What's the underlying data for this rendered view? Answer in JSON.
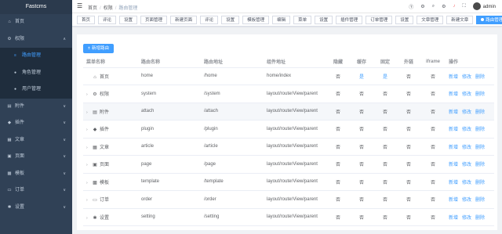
{
  "brand": "Fastcms",
  "sidebar": {
    "items": [
      {
        "label": "首页",
        "icon": "home-icon",
        "glyph": "⌂",
        "arrow": ""
      },
      {
        "label": "权限",
        "icon": "gear-icon",
        "glyph": "⚙",
        "arrow": "∧"
      },
      {
        "label": "附件",
        "icon": "folder-icon",
        "glyph": "▤",
        "arrow": "∨"
      },
      {
        "label": "插件",
        "icon": "plugin-icon",
        "glyph": "◆",
        "arrow": "∨"
      },
      {
        "label": "文章",
        "icon": "document-icon",
        "glyph": "▦",
        "arrow": "∨"
      },
      {
        "label": "页面",
        "icon": "page-icon",
        "glyph": "▣",
        "arrow": "∨"
      },
      {
        "label": "模板",
        "icon": "template-icon",
        "glyph": "▩",
        "arrow": "∨"
      },
      {
        "label": "订单",
        "icon": "cart-icon",
        "glyph": "▭",
        "arrow": "∨"
      },
      {
        "label": "设置",
        "icon": "settings-icon",
        "glyph": "✱",
        "arrow": "∨"
      }
    ],
    "sub_items": [
      {
        "label": "路由管理",
        "icon": "menu-icon",
        "glyph": "≡",
        "active": true
      },
      {
        "label": "角色管理",
        "icon": "user-icon",
        "glyph": "●",
        "active": false
      },
      {
        "label": "用户管理",
        "icon": "user-icon",
        "glyph": "●",
        "active": false
      }
    ]
  },
  "breadcrumb": [
    "首页",
    "权限",
    "路由管理"
  ],
  "header": {
    "user": "admin"
  },
  "tags": [
    {
      "label": "首页",
      "active": false
    },
    {
      "label": "评论",
      "active": false
    },
    {
      "label": "设置",
      "active": false
    },
    {
      "label": "页面管理",
      "active": false
    },
    {
      "label": "新建页面",
      "active": false
    },
    {
      "label": "评论",
      "active": false
    },
    {
      "label": "设置",
      "active": false
    },
    {
      "label": "模板管理",
      "active": false
    },
    {
      "label": "编辑",
      "active": false
    },
    {
      "label": "菜单",
      "active": false
    },
    {
      "label": "设置",
      "active": false
    },
    {
      "label": "插件管理",
      "active": false
    },
    {
      "label": "订单管理",
      "active": false
    },
    {
      "label": "设置",
      "active": false
    },
    {
      "label": "文章管理",
      "active": false
    },
    {
      "label": "新建文章",
      "active": false
    },
    {
      "label": "路由管理",
      "active": true
    }
  ],
  "toolbar": {
    "new_button": "新增路由"
  },
  "table": {
    "columns": [
      "菜单名称",
      "路由名称",
      "路由地址",
      "组件地址",
      "隐藏",
      "缓存",
      "固定",
      "外链",
      "iframe",
      "操作"
    ],
    "actions": [
      "新增",
      "修改",
      "删除"
    ],
    "rows": [
      {
        "expand": "",
        "icon": "home-icon",
        "glyph": "⌂",
        "menu": "首页",
        "name": "home",
        "path": "/home",
        "component": "home/index",
        "hidden": "否",
        "cache": "是",
        "fixed": "是",
        "link": "否",
        "iframe": "否"
      },
      {
        "expand": "›",
        "icon": "gear-icon",
        "glyph": "⚙",
        "menu": "权限",
        "name": "system",
        "path": "/system",
        "component": "layout/routerView/parent",
        "hidden": "否",
        "cache": "否",
        "fixed": "否",
        "link": "否",
        "iframe": "否"
      },
      {
        "expand": "›",
        "icon": "folder-icon",
        "glyph": "▤",
        "menu": "附件",
        "name": "attach",
        "path": "/attach",
        "component": "layout/routerView/parent",
        "hidden": "否",
        "cache": "否",
        "fixed": "否",
        "link": "否",
        "iframe": "否"
      },
      {
        "expand": "›",
        "icon": "plugin-icon",
        "glyph": "◆",
        "menu": "插件",
        "name": "plugin",
        "path": "/plugin",
        "component": "layout/routerView/parent",
        "hidden": "否",
        "cache": "否",
        "fixed": "否",
        "link": "否",
        "iframe": "否"
      },
      {
        "expand": "›",
        "icon": "document-icon",
        "glyph": "▦",
        "menu": "文章",
        "name": "article",
        "path": "/article",
        "component": "layout/routerView/parent",
        "hidden": "否",
        "cache": "否",
        "fixed": "否",
        "link": "否",
        "iframe": "否"
      },
      {
        "expand": "›",
        "icon": "page-icon",
        "glyph": "▣",
        "menu": "页面",
        "name": "page",
        "path": "/page",
        "component": "layout/routerView/parent",
        "hidden": "否",
        "cache": "否",
        "fixed": "否",
        "link": "否",
        "iframe": "否"
      },
      {
        "expand": "›",
        "icon": "template-icon",
        "glyph": "▩",
        "menu": "模板",
        "name": "template",
        "path": "/template",
        "component": "layout/routerView/parent",
        "hidden": "否",
        "cache": "否",
        "fixed": "否",
        "link": "否",
        "iframe": "否"
      },
      {
        "expand": "›",
        "icon": "cart-icon",
        "glyph": "▭",
        "menu": "订单",
        "name": "order",
        "path": "/order",
        "component": "layout/routerView/parent",
        "hidden": "否",
        "cache": "否",
        "fixed": "否",
        "link": "否",
        "iframe": "否"
      },
      {
        "expand": "›",
        "icon": "settings-icon",
        "glyph": "✱",
        "menu": "设置",
        "name": "setting",
        "path": "/setting",
        "component": "layout/routerView/parent",
        "hidden": "否",
        "cache": "否",
        "fixed": "否",
        "link": "否",
        "iframe": "否"
      }
    ]
  },
  "colors": {
    "sidebar_bg": "#304156",
    "accent": "#409eff"
  }
}
